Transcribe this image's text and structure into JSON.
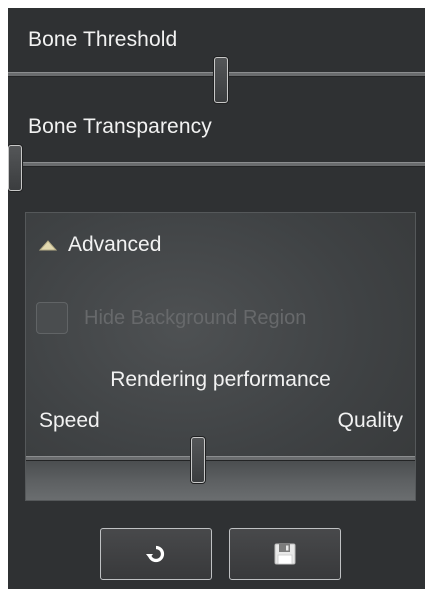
{
  "bone_threshold": {
    "label": "Bone Threshold",
    "value": 0.51
  },
  "bone_transparency": {
    "label": "Bone Transparency",
    "value": 0.0
  },
  "advanced": {
    "title": "Advanced",
    "expanded": true,
    "hide_background": {
      "label": "Hide Background Region",
      "checked": false,
      "enabled": false
    },
    "rendering_performance": {
      "title": "Rendering performance",
      "min_label": "Speed",
      "max_label": "Quality",
      "value": 0.44
    }
  },
  "buttons": {
    "reset_icon": "refresh-icon",
    "save_icon": "floppy-disk-icon"
  },
  "colors": {
    "panel_bg": "#2f3133",
    "text": "#f2f2f2",
    "disabled_text": "#67696b",
    "caret": "#e3d9b0"
  }
}
